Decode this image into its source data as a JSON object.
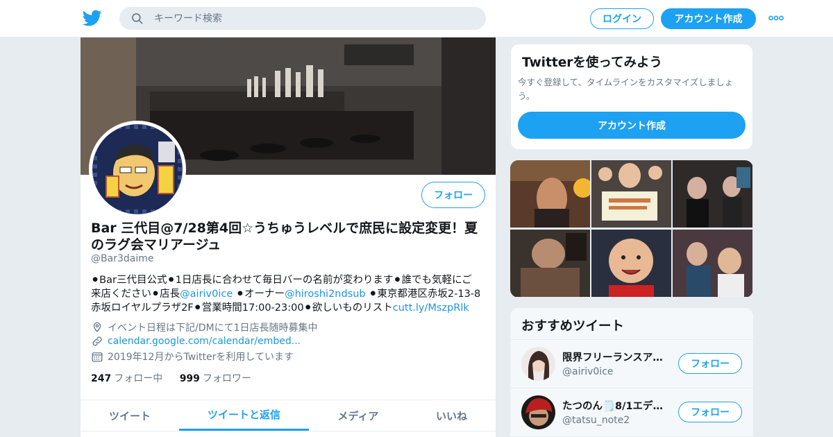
{
  "header": {
    "logo_icon": "twitter-bird-icon",
    "search_placeholder": "キーワード検索",
    "login_label": "ログイン",
    "signup_label": "アカウント作成",
    "more_icon": "more-dots-icon"
  },
  "profile": {
    "name": "Bar 三代目@7/28第4回☆うちゅうレベルで庶民に設定変更！夏のラグ会マリアージュ",
    "handle": "@Bar3daime",
    "follow_label": "フォロー",
    "bio": {
      "line1": "⚫︎Bar三代目公式⚫︎1日店長に合わせて毎日バーの名前が変わります⚫誰でも気軽にご",
      "line2_pre": "来店ください⚫店長",
      "mention1": "@airiv0ice",
      "line2_mid": " ⚫︎オーナー",
      "mention2": "@hiroshi2ndsub",
      "line2_post": " ⚫︎東京都港区赤坂2-13-8",
      "line3_pre": "赤坂ロイヤルプラザ2F⚫︎営業時間17:00-23:00⚫︎欲しいものリスト",
      "link": "cutt.ly/MszpRlk"
    },
    "location": "イベント日程は下記/DMにて1日店長随時募集中",
    "url": "calendar.google.com/calendar/embed...",
    "joined": "2019年12月からTwitterを利用しています",
    "following_count": "247",
    "following_label": "フォロー中",
    "followers_count": "999",
    "followers_label": "フォロワー",
    "tabs": [
      "ツイート",
      "ツイートと返信",
      "メディア",
      "いいね"
    ],
    "active_tab": "ツイートと返信"
  },
  "signup_card": {
    "title": "Twitterを使ってみよう",
    "text": "今すぐ登録して、タイムラインをカスタマイズしましょう。",
    "button": "アカウント作成"
  },
  "recommended": {
    "title": "おすすめツイート",
    "items": [
      {
        "name": "限界フリーランスア…",
        "handle": "@airiv0ice",
        "follow_label": "フォロー"
      },
      {
        "name": "たつのん🗒️8/1エデ…",
        "handle": "@tatsu_note2",
        "follow_label": "フォロー"
      }
    ]
  },
  "colors": {
    "accent": "#1da1f2",
    "link": "#1b95e0",
    "muted": "#657786",
    "background": "#e6ecf0"
  }
}
